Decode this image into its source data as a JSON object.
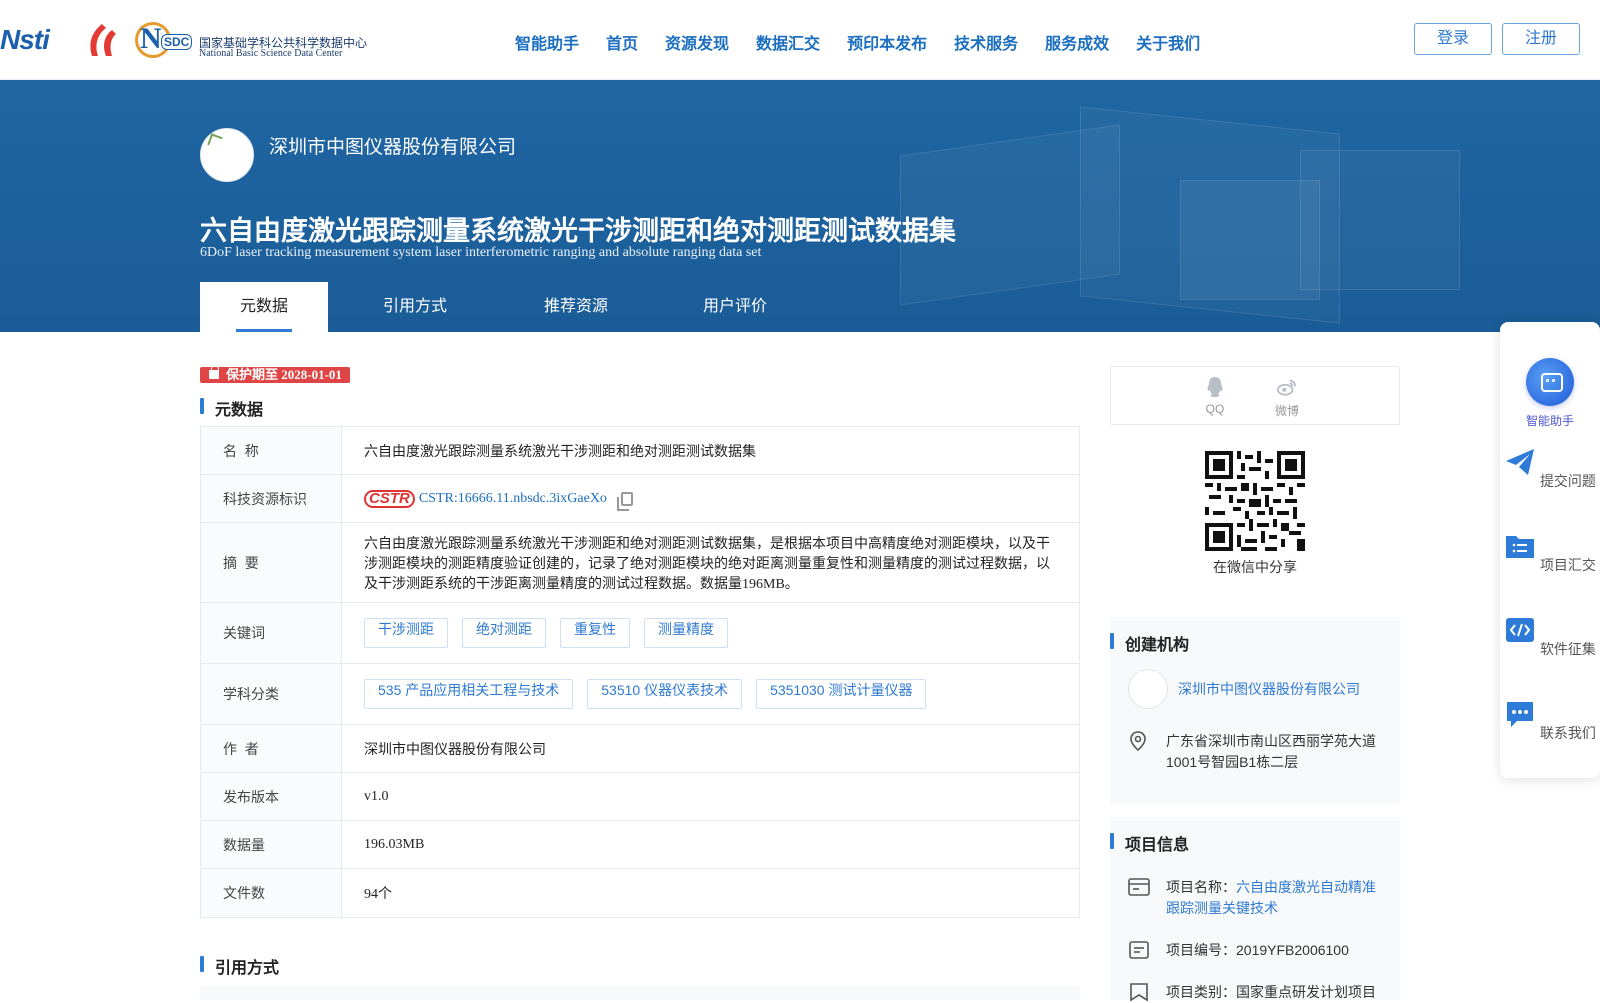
{
  "header": {
    "logo_nsti": "Nsti",
    "logo_nsdc_cn": "国家基础学科公共科学数据中心",
    "logo_nsdc_en": "National Basic Science Data Center",
    "nav": [
      "智能助手",
      "首页",
      "资源发现",
      "数据汇交",
      "预印本发布",
      "技术服务",
      "服务成效",
      "关于我们"
    ],
    "login_label": "登录",
    "register_label": "注册"
  },
  "banner": {
    "org_name": "深圳市中图仪器股份有限公司",
    "title": "六自由度激光跟踪测量系统激光干涉测距和绝对测距测试数据集",
    "subtitle": "6DoF laser tracking measurement system laser interferometric ranging and absolute ranging data set",
    "tabs": [
      "元数据",
      "引用方式",
      "推荐资源",
      "用户评价"
    ]
  },
  "protect_badge": "保护期至 2028-01-01",
  "metadata": {
    "section_title": "元数据",
    "name_label": "名  称",
    "name_value": "六自由度激光跟踪测量系统激光干涉测距和绝对测距测试数据集",
    "cstr_label": "科技资源标识",
    "cstr_mark": "CSTR",
    "cstr_value": "CSTR:16666.11.nbsdc.3ixGaeXo",
    "abstract_label": "摘  要",
    "abstract_value": "六自由度激光跟踪测量系统激光干涉测距和绝对测距测试数据集，是根据本项目中高精度绝对测距模块，以及干涉测距模块的测距精度验证创建的，记录了绝对测距模块的绝对距离测量重复性和测量精度的测试过程数据，以及干涉测距系统的干涉距离测量精度的测试过程数据。数据量196MB。",
    "keywords_label": "关键词",
    "keywords": [
      "干涉测距",
      "绝对测距",
      "重复性",
      "测量精度"
    ],
    "subject_label": "学科分类",
    "subjects": [
      "535 产品应用相关工程与技术",
      "53510 仪器仪表技术",
      "5351030 测试计量仪器"
    ],
    "author_label": "作  者",
    "author_value": "深圳市中图仪器股份有限公司",
    "version_label": "发布版本",
    "version_value": "v1.0",
    "size_label": "数据量",
    "size_value": "196.03MB",
    "files_label": "文件数",
    "files_value": "94个"
  },
  "citation": {
    "section_title": "引用方式"
  },
  "share": {
    "qq_label": "QQ",
    "weibo_label": "微博",
    "wechat_caption": "在微信中分享"
  },
  "creator": {
    "section_title": "创建机构",
    "org_name": "深圳市中图仪器股份有限公司",
    "address": "广东省深圳市南山区西丽学苑大道1001号智园B1栋二层"
  },
  "project": {
    "section_title": "项目信息",
    "name_label": "项目名称：",
    "name_value": "六自由度激光自动精准跟踪测量关键技术",
    "code_label": "项目编号：",
    "code_value": "2019YFB2006100",
    "type_label": "项目类别：",
    "type_value": "国家重点研发计划项目"
  },
  "float_bar": {
    "assistant": "智能助手",
    "submit": "提交问题",
    "collect": "项目汇交",
    "software": "软件征集",
    "contact": "联系我们"
  },
  "colors": {
    "primary": "#2d7bd6",
    "banner": "#1f66a3",
    "badge": "#e04545"
  }
}
